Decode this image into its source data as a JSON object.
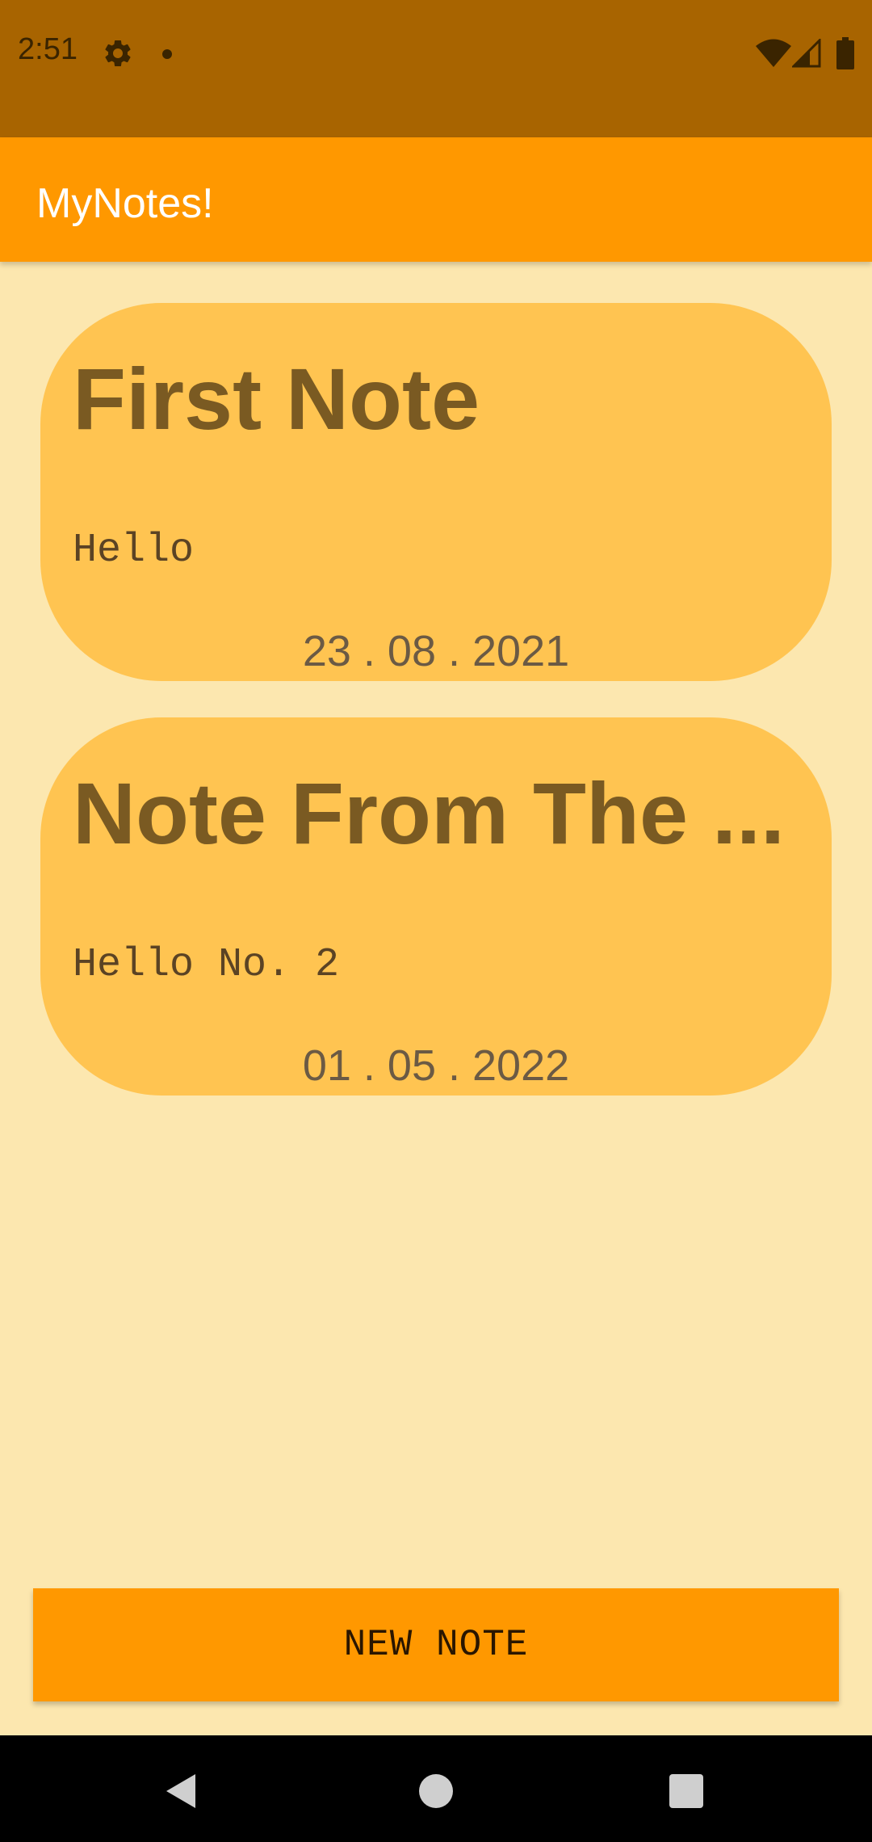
{
  "status_bar": {
    "time": "2:51",
    "icons": [
      "gear-icon",
      "notification-dot-icon",
      "wifi-icon",
      "cellular-signal-icon",
      "battery-icon"
    ]
  },
  "app_bar": {
    "title": "MyNotes!"
  },
  "notes": [
    {
      "title": "First Note",
      "body": "Hello",
      "date": "23 . 08 . 2021"
    },
    {
      "title": "Note From The ...",
      "body": "Hello No. 2",
      "date": "01 . 05 . 2022"
    }
  ],
  "actions": {
    "new_note_label": "NEW NOTE"
  },
  "nav_bar": {
    "icons": [
      "back-icon",
      "home-icon",
      "recents-icon"
    ]
  },
  "colors": {
    "status_bar": "#A86400",
    "app_bar": "#FF9800",
    "background": "#FCE7AF",
    "card": "#FFC451",
    "card_title": "#7A5A22",
    "button": "#FF9800"
  }
}
